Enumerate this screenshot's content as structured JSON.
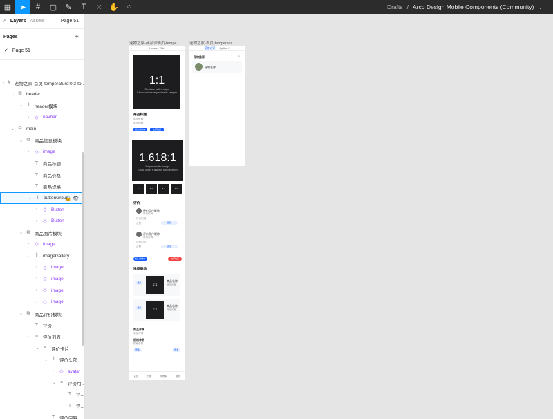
{
  "toolbar": {
    "menu_icon": "figma-menu-icon",
    "move_tool": "move-tool-icon",
    "frame_tool": "frame-tool-icon",
    "shape_tool": "rectangle-tool-icon",
    "pen_tool": "pen-tool-icon",
    "text_tool": "text-tool-icon",
    "component_tool": "components-tool-icon",
    "hand_tool": "hand-tool-icon",
    "comment_tool": "comment-tool-icon"
  },
  "breadcrumb": {
    "project": "Drafts",
    "separator": "/",
    "file": "Arco Design Mobile Components (Community)",
    "chevron": "⌄"
  },
  "sidebar": {
    "tab_layers": "Layers",
    "tab_assets": "Assets",
    "page_select": "Page 51",
    "pages_title": "Pages",
    "add_page": "+",
    "current_page": "Page 51",
    "layers": [
      {
        "label": "宠物之家-首页-temperature:0.3-to...",
        "indent": 0,
        "icon": "#",
        "caret": "›",
        "type": "frame"
      },
      {
        "label": "header",
        "indent": 1,
        "icon": "⧉",
        "caret": "⌄",
        "type": "frame"
      },
      {
        "label": "header模块",
        "indent": 2,
        "icon": "⦀",
        "caret": "⌄",
        "type": "frame"
      },
      {
        "label": "navbar",
        "indent": 3,
        "icon": "◇",
        "caret": "›",
        "type": "comp"
      },
      {
        "label": "main",
        "indent": 1,
        "icon": "⧉",
        "caret": "⌄",
        "type": "frame"
      },
      {
        "label": "商品信息模块",
        "indent": 2,
        "icon": "⧉",
        "caret": "⌄",
        "type": "frame"
      },
      {
        "label": "image",
        "indent": 3,
        "icon": "◇",
        "caret": "›",
        "type": "comp"
      },
      {
        "label": "商品标题",
        "indent": 3,
        "icon": "T",
        "caret": "",
        "type": "text"
      },
      {
        "label": "商品价格",
        "indent": 3,
        "icon": "T",
        "caret": "",
        "type": "text"
      },
      {
        "label": "商品规格",
        "indent": 3,
        "icon": "T",
        "caret": "",
        "type": "text"
      },
      {
        "label": "buttonGroup",
        "indent": 3,
        "icon": "⦀",
        "caret": "⌄",
        "type": "hl"
      },
      {
        "label": "Button",
        "indent": 4,
        "icon": "◇",
        "caret": "›",
        "type": "comp"
      },
      {
        "label": "Button",
        "indent": 4,
        "icon": "◇",
        "caret": "›",
        "type": "comp"
      },
      {
        "label": "商品图片模块",
        "indent": 2,
        "icon": "⧉",
        "caret": "⌄",
        "type": "frame"
      },
      {
        "label": "image",
        "indent": 3,
        "icon": "◇",
        "caret": "›",
        "type": "comp"
      },
      {
        "label": "imageGallery",
        "indent": 3,
        "icon": "⦀",
        "caret": "⌄",
        "type": "frame"
      },
      {
        "label": "image",
        "indent": 4,
        "icon": "◇",
        "caret": "›",
        "type": "comp"
      },
      {
        "label": "image",
        "indent": 4,
        "icon": "◇",
        "caret": "›",
        "type": "comp"
      },
      {
        "label": "image",
        "indent": 4,
        "icon": "◇",
        "caret": "›",
        "type": "comp"
      },
      {
        "label": "image",
        "indent": 4,
        "icon": "◇",
        "caret": "›",
        "type": "comp"
      },
      {
        "label": "商品评价模块",
        "indent": 2,
        "icon": "⧉",
        "caret": "⌄",
        "type": "frame"
      },
      {
        "label": "评价",
        "indent": 3,
        "icon": "T",
        "caret": "",
        "type": "text"
      },
      {
        "label": "评价列表",
        "indent": 3,
        "icon": "≡",
        "caret": "⌄",
        "type": "frame"
      },
      {
        "label": "评价卡片",
        "indent": 4,
        "icon": "≡",
        "caret": "⌄",
        "type": "frame"
      },
      {
        "label": "评价头部",
        "indent": 5,
        "icon": "⦀",
        "caret": "⌄",
        "type": "frame"
      },
      {
        "label": "avatar",
        "indent": 6,
        "icon": "◇",
        "caret": "›",
        "type": "comp"
      },
      {
        "label": "评价用...",
        "indent": 6,
        "icon": "≡",
        "caret": "⌄",
        "type": "frame"
      },
      {
        "label": "评...",
        "indent": 7,
        "icon": "T",
        "caret": "",
        "type": "text"
      },
      {
        "label": "评...",
        "indent": 7,
        "icon": "T",
        "caret": "",
        "type": "text"
      },
      {
        "label": "评价内容",
        "indent": 5,
        "icon": "T",
        "caret": "",
        "type": "text"
      },
      {
        "label": "评价操作",
        "indent": 5,
        "icon": "⦀",
        "caret": "›",
        "type": "frame"
      }
    ]
  },
  "canvas": {
    "frame1_label": "宠物之家-商品详情页-tempe...",
    "frame2_label": "宠物之家-首页-temperatu...",
    "frame1": {
      "header_title": "Header Title",
      "img1_ratio": "1:1",
      "img1_line1": "Replace with image",
      "img1_line2": "Shoic cuter's aspect ratio keeper",
      "product_title": "商品标题",
      "price": "商品价格",
      "spec": "商品规格",
      "btn1": "加入购物车",
      "btn2": "立即购买",
      "img2_ratio": "1.618:1",
      "img2_line1": "Replace with image",
      "img2_line2": "Shoic cuter's aspect ratio keeper",
      "thumb": "1:1",
      "reviews_title": "评价",
      "reviewer1": "评价用户昵称",
      "reviewer2": "评价用户昵称",
      "review_meta": "评价时间",
      "review_text": "评价内容",
      "like": "点赞",
      "reply": "回复",
      "cart_btn": "加入购物车",
      "buy_btn": "立即购买",
      "recommend_title": "推荐商品",
      "rec_name": "商品名称",
      "rec_price": "商品价格",
      "detail_title": "商品详情",
      "spec_title": "规格参数",
      "tabs": [
        "首页",
        "分类",
        "购物车",
        "我的"
      ],
      "more": "更多"
    },
    "frame2": {
      "tab1": "宠物之家",
      "tab2": "Option 2",
      "section": "宠物推荐",
      "pet_name": "宠物名称"
    }
  }
}
